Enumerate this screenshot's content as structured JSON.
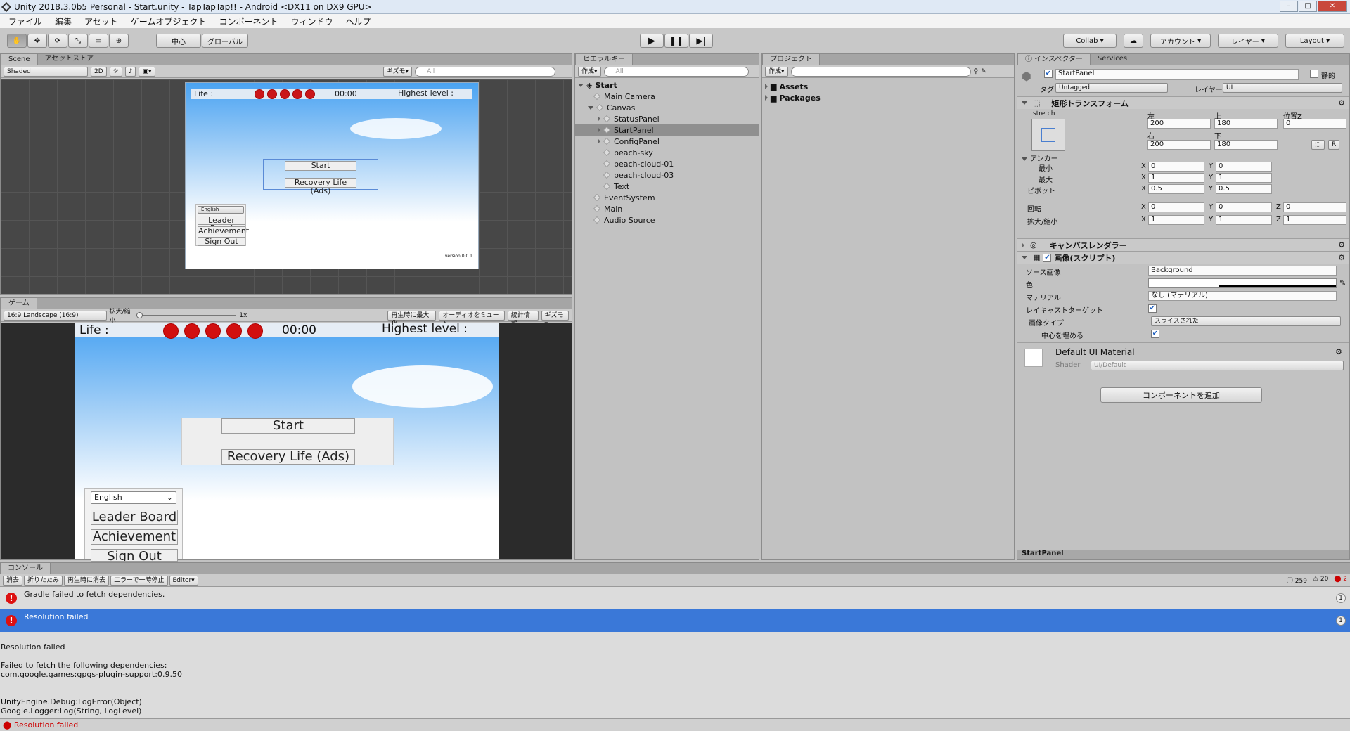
{
  "window": {
    "title": "Unity 2018.3.0b5 Personal - Start.unity - TapTapTap!! - Android <DX11 on DX9 GPU>"
  },
  "menu": [
    "ファイル",
    "編集",
    "アセット",
    "ゲームオブジェクト",
    "コンポーネント",
    "ウィンドウ",
    "ヘルプ"
  ],
  "toolbar": {
    "pivot": "中心",
    "space": "グローバル",
    "collab": "Collab",
    "account": "アカウント",
    "layers": "レイヤー",
    "layout": "Layout"
  },
  "scene": {
    "tab": "Scene",
    "tab2": "アセットストア",
    "shading": "Shaded",
    "mode2d": "2D",
    "gizmos": "ギズモ",
    "search": "All",
    "life": "Life :",
    "time": "00:00",
    "highest": "Highest level :",
    "start": "Start",
    "recovery": "Recovery Life (Ads)",
    "lang": "English",
    "leader": "Leader Board",
    "achievement": "Achievement",
    "signout": "Sign Out",
    "version": "version 0.0.1"
  },
  "game": {
    "tab": "ゲーム",
    "aspect": "16:9 Landscape (16:9)",
    "scale": "拡大/縮小",
    "scale_val": "1x",
    "maximize": "再生時に最大化",
    "mute": "オーディオをミュート",
    "stats": "統計情報",
    "gizmos": "ギズモ",
    "life": "Life :",
    "time": "00:00",
    "highest": "Highest level :",
    "start": "Start",
    "recovery": "Recovery Life (Ads)",
    "lang": "English",
    "leader": "Leader Board",
    "achievement": "Achievement",
    "signout": "Sign Out"
  },
  "hierarchy": {
    "tab": "ヒエラルキー",
    "create": "作成",
    "search": "All",
    "scene": "Start",
    "items": [
      {
        "name": "Main Camera",
        "indent": 1
      },
      {
        "name": "Canvas",
        "indent": 1,
        "expanded": true
      },
      {
        "name": "StatusPanel",
        "indent": 2,
        "arrow": true
      },
      {
        "name": "StartPanel",
        "indent": 2,
        "arrow": true,
        "selected": true
      },
      {
        "name": "ConfigPanel",
        "indent": 2,
        "arrow": true
      },
      {
        "name": "beach-sky",
        "indent": 2
      },
      {
        "name": "beach-cloud-01",
        "indent": 2
      },
      {
        "name": "beach-cloud-03",
        "indent": 2
      },
      {
        "name": "Text",
        "indent": 2
      },
      {
        "name": "EventSystem",
        "indent": 1
      },
      {
        "name": "Main",
        "indent": 1
      },
      {
        "name": "Audio Source",
        "indent": 1
      }
    ]
  },
  "project": {
    "tab": "プロジェクト",
    "create": "作成",
    "folders": [
      "Assets",
      "Packages"
    ]
  },
  "inspector": {
    "tab": "インスペクター",
    "tab2": "Services",
    "name": "StartPanel",
    "static": "静的",
    "tag_label": "タグ",
    "tag": "Untagged",
    "layer_label": "レイヤー",
    "layer": "UI",
    "rect": {
      "title": "矩形トランスフォーム",
      "stretch": "stretch",
      "left_l": "左",
      "top_l": "上",
      "posz_l": "位置Z",
      "right_l": "右",
      "bottom_l": "下",
      "left": "200",
      "top": "180",
      "posz": "0",
      "right": "200",
      "bottom": "180",
      "anchors": "アンカー",
      "min": "最小",
      "max": "最大",
      "minx": "0",
      "miny": "0",
      "maxx": "1",
      "maxy": "1",
      "pivot": "ピボット",
      "pivx": "0.5",
      "pivy": "0.5",
      "rotation": "回転",
      "rx": "0",
      "ry": "0",
      "rz": "0",
      "scale": "拡大/縮小",
      "sx": "1",
      "sy": "1",
      "sz": "1"
    },
    "canvasRenderer": "キャンバスレンダラー",
    "image": {
      "title": "画像(スクリプト)",
      "source_l": "ソース画像",
      "source": "Background",
      "color_l": "色",
      "material_l": "マテリアル",
      "material": "なし (マテリアル)",
      "raycast_l": "レイキャストターゲット",
      "type_l": "画像タイプ",
      "type": "スライスされた",
      "fill_l": "中心を埋める"
    },
    "material": {
      "name": "Default UI Material",
      "shader_l": "Shader",
      "shader": "UI/Default"
    },
    "addComponent": "コンポーネントを追加",
    "footer": "StartPanel"
  },
  "console": {
    "tab": "コンソール",
    "clear": "消去",
    "collapse": "折りたたみ",
    "clearOnPlay": "再生時に消去",
    "errorPause": "エラーで一時停止",
    "editor": "Editor",
    "logCount": "259",
    "warnCount": "20",
    "errCount": "2",
    "entries": [
      {
        "text": "Gradle failed to fetch dependencies.",
        "count": "1"
      },
      {
        "text": "Resolution failed",
        "count": "1"
      }
    ],
    "detail": [
      "Resolution failed",
      "",
      "Failed to fetch the following dependencies:",
      "com.google.games:gpgs-plugin-support:0.9.50",
      "",
      "",
      "UnityEngine.Debug:LogError(Object)",
      "Google.Logger:Log(String, LogLevel)"
    ],
    "status": "Resolution failed"
  }
}
